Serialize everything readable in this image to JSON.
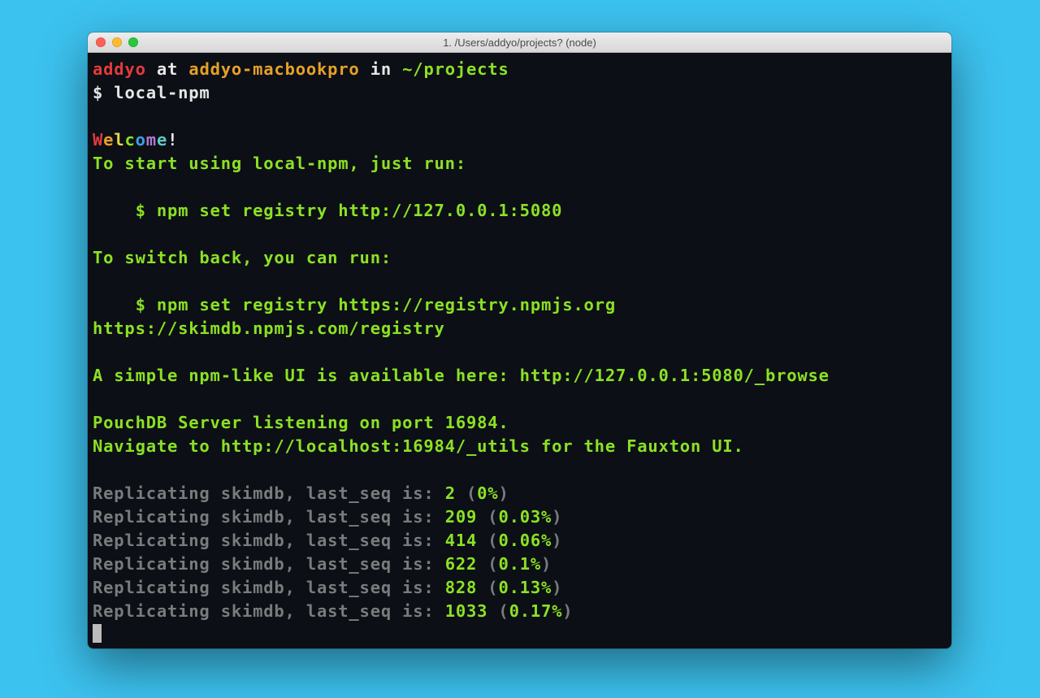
{
  "window": {
    "title": "1. /Users/addyo/projects? (node)"
  },
  "prompt": {
    "user": "addyo",
    "at": " at ",
    "host": "addyo-macbookpro",
    "in": " in ",
    "path": "~/projects",
    "dollar": "$ ",
    "command": "local-npm"
  },
  "welcome": {
    "letters": [
      "W",
      "e",
      "l",
      "c",
      "o",
      "m",
      "e",
      "!"
    ],
    "colors": [
      "#e23b3b",
      "#e6a128",
      "#e8d64c",
      "#8be124",
      "#3aa0e0",
      "#b178d3",
      "#5fc9c2",
      "#e6e6e6"
    ]
  },
  "body": {
    "line_start": "To start using local-npm, just run:",
    "cmd_set_local": "    $ npm set registry http://127.0.0.1:5080",
    "line_switch": "To switch back, you can run:",
    "cmd_set_default": "    $ npm set registry https://registry.npmjs.org",
    "skimdb_url": "https://skimdb.npmjs.com/registry",
    "ui_line": "A simple npm-like UI is available here: http://127.0.0.1:5080/_browse",
    "pouch_line": "PouchDB Server listening on port 16984.",
    "fauxton_line": "Navigate to http://localhost:16984/_utils for the Fauxton UI."
  },
  "replication": {
    "prefix": "Replicating skimdb, last_seq is: ",
    "rows": [
      {
        "seq": "2",
        "pct": "0%"
      },
      {
        "seq": "209",
        "pct": "0.03%"
      },
      {
        "seq": "414",
        "pct": "0.06%"
      },
      {
        "seq": "622",
        "pct": "0.1%"
      },
      {
        "seq": "828",
        "pct": "0.13%"
      },
      {
        "seq": "1033",
        "pct": "0.17%"
      }
    ]
  }
}
